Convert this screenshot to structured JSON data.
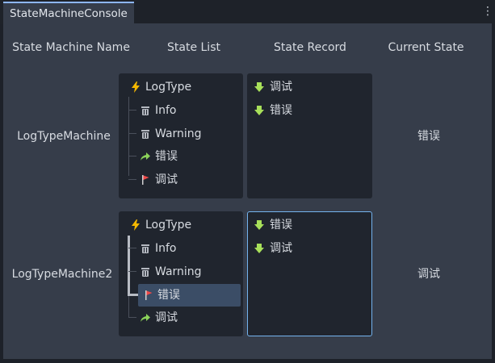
{
  "tab": {
    "title": "StateMachineConsole"
  },
  "columns": {
    "name": "State Machine Name",
    "list": "State List",
    "record": "State Record",
    "current": "Current State"
  },
  "machines": [
    {
      "name": "LogTypeMachine",
      "root": "LogType",
      "states": [
        {
          "label": "Info",
          "icon": "trash-icon"
        },
        {
          "label": "Warning",
          "icon": "trash-icon"
        },
        {
          "label": "错误",
          "icon": "arrow-right-icon"
        },
        {
          "label": "调试",
          "icon": "flag-icon"
        }
      ],
      "records": [
        {
          "label": "调试",
          "icon": "down-arrow-icon"
        },
        {
          "label": "错误",
          "icon": "down-arrow-icon"
        }
      ],
      "current": "错误"
    },
    {
      "name": "LogTypeMachine2",
      "root": "LogType",
      "states": [
        {
          "label": "Info",
          "icon": "trash-icon"
        },
        {
          "label": "Warning",
          "icon": "trash-icon"
        },
        {
          "label": "错误",
          "icon": "flag-icon",
          "selected": true
        },
        {
          "label": "调试",
          "icon": "arrow-right-icon"
        }
      ],
      "records": [
        {
          "label": "错误",
          "icon": "down-arrow-icon"
        },
        {
          "label": "调试",
          "icon": "down-arrow-icon"
        }
      ],
      "current": "调试"
    }
  ],
  "colors": {
    "bolt": "#f5b800",
    "trash": "#b4b8c0",
    "arrow": "#8bd35a",
    "flag": "#f04848",
    "record": "#a8e05a"
  }
}
